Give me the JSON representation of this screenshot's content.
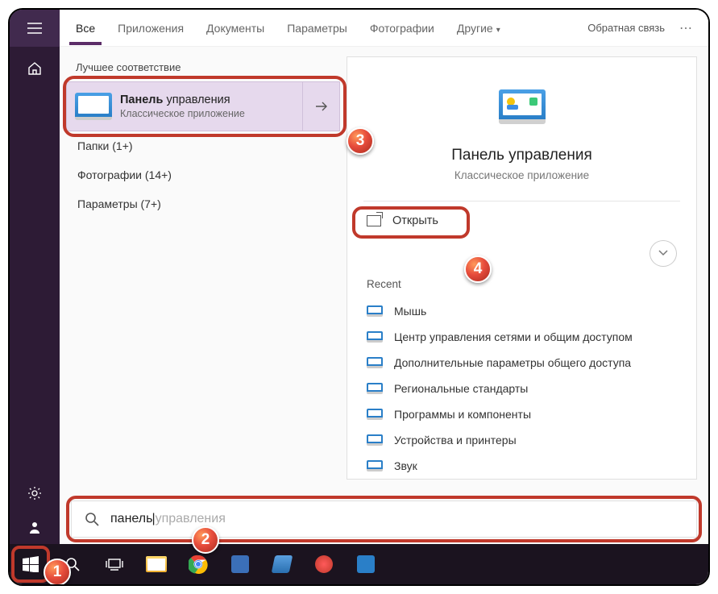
{
  "tabs": {
    "all": "Все",
    "apps": "Приложения",
    "docs": "Документы",
    "settings": "Параметры",
    "photos": "Фотографии",
    "more": "Другие"
  },
  "feedback": "Обратная связь",
  "section_best": "Лучшее соответствие",
  "best_match": {
    "title_hl": "Панель",
    "title_rest": " управления",
    "subtitle": "Классическое приложение"
  },
  "subresults": {
    "folders": "Папки (1+)",
    "photos": "Фотографии (14+)",
    "params": "Параметры (7+)"
  },
  "preview": {
    "title": "Панель управления",
    "subtitle": "Классическое приложение",
    "open": "Открыть"
  },
  "recent": {
    "label": "Recent",
    "items": [
      "Мышь",
      "Центр управления сетями и общим доступом",
      "Дополнительные параметры общего доступа",
      "Региональные стандарты",
      "Программы и компоненты",
      "Устройства и принтеры",
      "Звук"
    ]
  },
  "search": {
    "typed": "панель",
    "ghost": " управления"
  },
  "badges": {
    "b1": "1",
    "b2": "2",
    "b3": "3",
    "b4": "4"
  }
}
